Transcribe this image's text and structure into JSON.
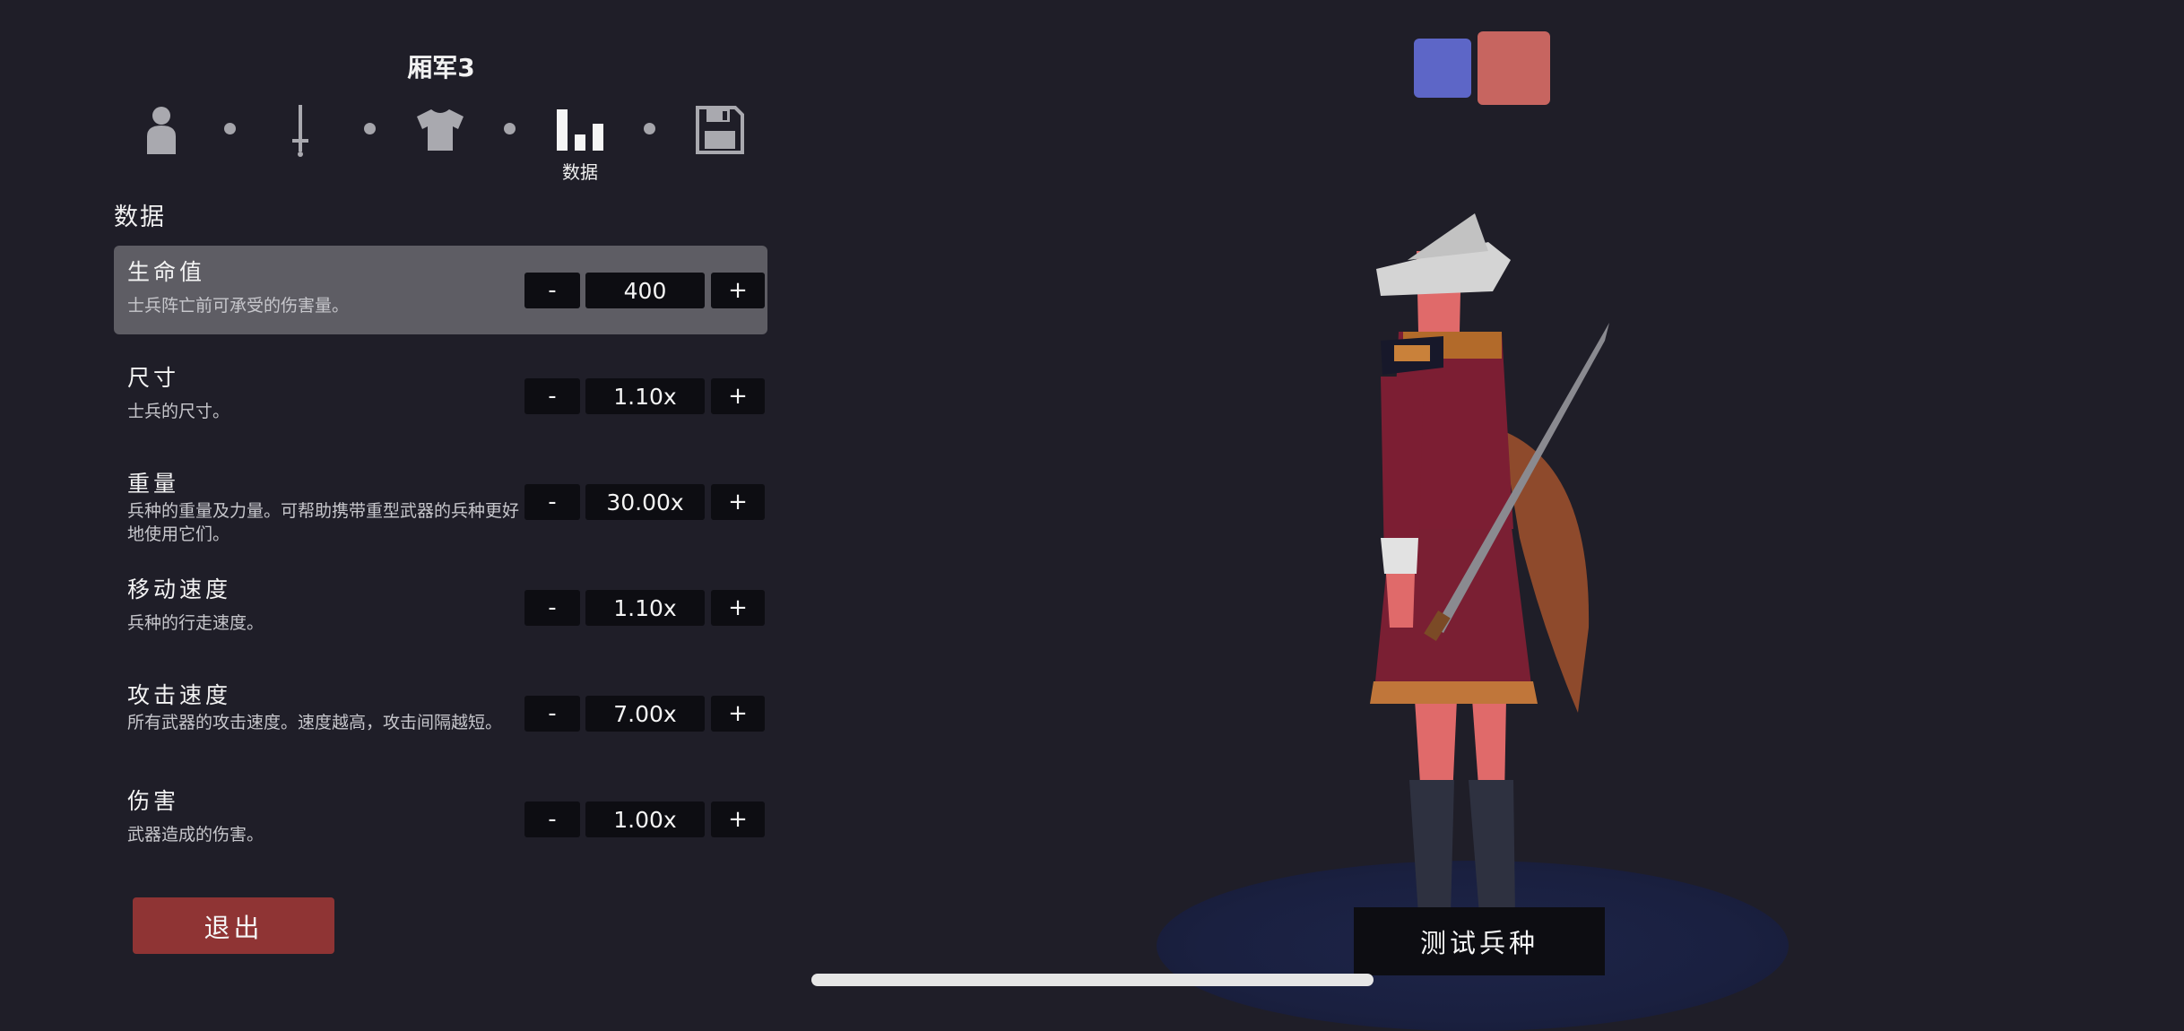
{
  "unit": {
    "name": "厢军3"
  },
  "steps": [
    {
      "icon": "person-icon"
    },
    {
      "icon": "sword-icon"
    },
    {
      "icon": "shirt-icon"
    },
    {
      "icon": "bar-chart-icon",
      "label": "数据",
      "active": true
    },
    {
      "icon": "save-icon"
    }
  ],
  "section": {
    "title": "数据"
  },
  "stats": [
    {
      "name": "生命值",
      "desc": "士兵阵亡前可承受的伤害量。",
      "value": "400",
      "minus": "-",
      "plus": "+"
    },
    {
      "name": "尺寸",
      "desc": "士兵的尺寸。",
      "value": "1.10x",
      "minus": "-",
      "plus": "+"
    },
    {
      "name": "重量",
      "desc": "兵种的重量及力量。可帮助携带重型武器的兵种更好地使用它们。",
      "value": "30.00x",
      "minus": "-",
      "plus": "+"
    },
    {
      "name": "移动速度",
      "desc": "兵种的行走速度。",
      "value": "1.10x",
      "minus": "-",
      "plus": "+"
    },
    {
      "name": "攻击速度",
      "desc": "所有武器的攻击速度。速度越高，攻击间隔越短。",
      "value": "7.00x",
      "minus": "-",
      "plus": "+"
    },
    {
      "name": "伤害",
      "desc": "武器造成的伤害。",
      "value": "1.00x",
      "minus": "-",
      "plus": "+"
    }
  ],
  "buttons": {
    "exit": "退出",
    "test": "测试兵种"
  },
  "colors": {
    "team_blue": "#5d66c7",
    "team_red": "#c76560",
    "exit": "#8f3434",
    "selected_row": "#5e5d64"
  }
}
